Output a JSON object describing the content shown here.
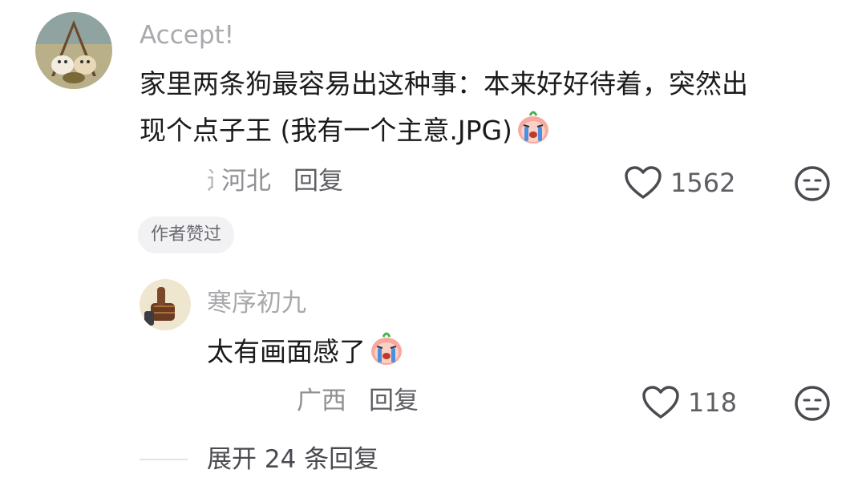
{
  "comment": {
    "username": "Accept!",
    "text_line1": "家里两条狗最容易出这种事：本来好好待着，突然出",
    "text_line2": "现个点子王 (我有一个主意.JPG)",
    "emoji_icon": "crying-face-sticker-icon",
    "partial_location_fragment": "辽",
    "location": "河北",
    "reply_label": "回复",
    "like_count": "1562",
    "author_badge": "作者赞过"
  },
  "reply": {
    "username": "寒序初九",
    "text": "太有画面感了",
    "emoji_icon": "crying-face-sticker-icon",
    "location": "广西",
    "reply_label": "回复",
    "like_count": "118"
  },
  "expand": {
    "label": "展开 24 条回复"
  },
  "colors": {
    "username": "#a9a9ad",
    "text": "#1b1b1b",
    "meta": "#8f8f94",
    "badge_bg": "#f2f2f4"
  }
}
